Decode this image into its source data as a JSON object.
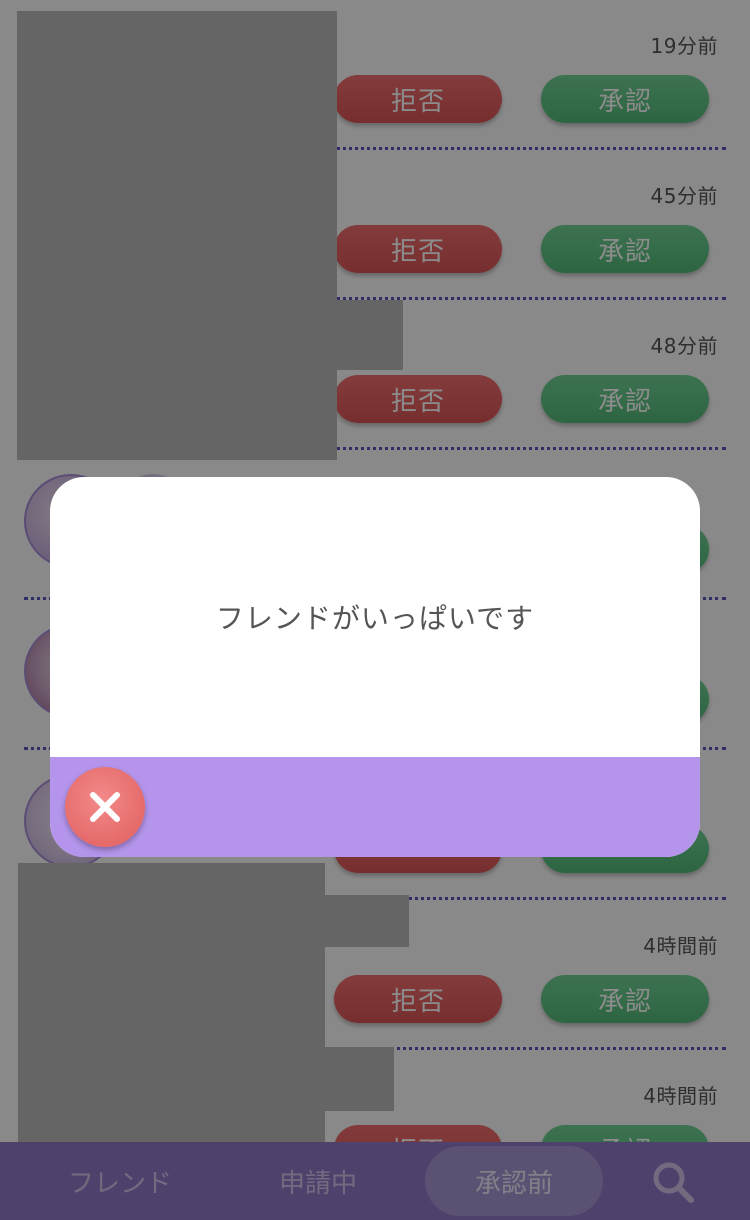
{
  "requests": [
    {
      "time": "19分前",
      "reject": "拒否",
      "approve": "承認"
    },
    {
      "time": "45分前",
      "reject": "拒否",
      "approve": "承認"
    },
    {
      "time": "48分前",
      "reject": "拒否",
      "approve": "承認"
    },
    {
      "time": "",
      "reject": "",
      "approve": ""
    },
    {
      "time": "",
      "reject": "",
      "approve": ""
    },
    {
      "time": "",
      "reject": "",
      "approve": ""
    },
    {
      "time": "4時間前",
      "reject": "拒否",
      "approve": "承認"
    },
    {
      "time": "4時間前",
      "reject": "拒否",
      "approve": "承認"
    }
  ],
  "tabs": {
    "friends": "フレンド",
    "applying": "申請中",
    "pending": "承認前"
  },
  "modal": {
    "message": "フレンドがいっぱいです"
  },
  "colors": {
    "accent": "#8e78c6",
    "modal_footer": "#b595ec",
    "reject": "#e05f5f",
    "approve": "#5ec483",
    "close": "#ea7373"
  },
  "icons": {
    "search": "search-icon",
    "close": "close-icon"
  }
}
